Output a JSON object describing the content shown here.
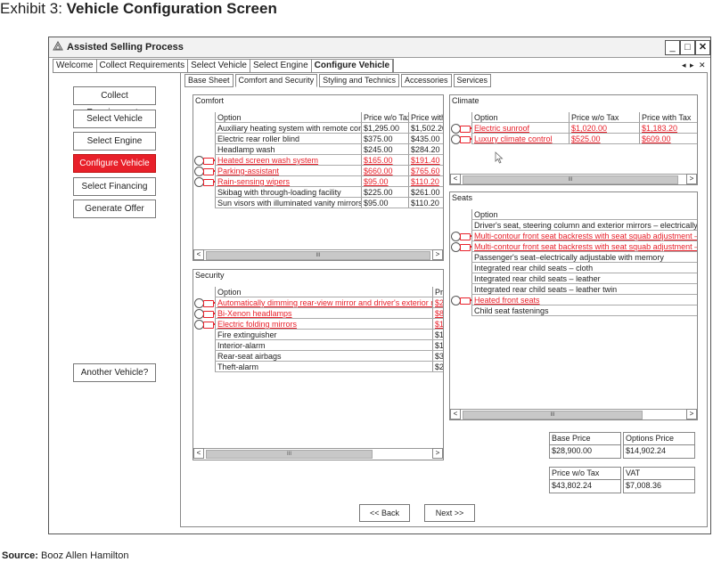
{
  "exhibit": {
    "prefix": "Exhibit 3: ",
    "title": "Vehicle Configuration Screen"
  },
  "source": {
    "label": "Source:",
    "text": " Booz Allen Hamilton"
  },
  "window": {
    "title": "Assisted Selling Process",
    "controls": {
      "minimize": "_",
      "maximize": "□",
      "close": "✕"
    }
  },
  "process_tabs": [
    "Welcome",
    "Collect Requirements",
    "Select Vehicle",
    "Select Engine",
    "Configure Vehicle"
  ],
  "tab_nav": {
    "left": "◂",
    "right": "▸",
    "close": "✕"
  },
  "sidebar": {
    "items": [
      "Collect Requirements",
      "Select Vehicle",
      "Select Engine",
      "Configure Vehicle",
      "Select Financing",
      "Generate Offer"
    ],
    "another": "Another Vehicle?"
  },
  "config_tabs": [
    "Base Sheet",
    "Comfort and Security",
    "Styling and Technics",
    "Accessories",
    "Services"
  ],
  "comfort": {
    "title": "Comfort",
    "headers": [
      "Option",
      "Price w/o Tax",
      "Price with"
    ],
    "rows": [
      {
        "option": "Auxiliary heating system with remote conrol",
        "p1": "$1,295.00",
        "p2": "$1,502.20",
        "sel": false
      },
      {
        "option": "Electric rear roller blind",
        "p1": "$375.00",
        "p2": "$435.00",
        "sel": false
      },
      {
        "option": "Headlamp wash",
        "p1": "$245.00",
        "p2": "$284.20",
        "sel": false
      },
      {
        "option": "Heated screen wash system",
        "p1": "$165.00",
        "p2": "$191.40",
        "sel": true
      },
      {
        "option": "Parking-assistant",
        "p1": "$660.00",
        "p2": "$765.60",
        "sel": true
      },
      {
        "option": "Rain-sensing wipers",
        "p1": "$95.00",
        "p2": "$110.20",
        "sel": true
      },
      {
        "option": "Skibag with through-loading facility",
        "p1": "$225.00",
        "p2": "$261.00",
        "sel": false
      },
      {
        "option": "Sun visors with illuminated vanity mirrors",
        "p1": "$95.00",
        "p2": "$110.20",
        "sel": false
      }
    ]
  },
  "security": {
    "title": "Security",
    "headers": [
      "Option",
      "Pri"
    ],
    "rows": [
      {
        "option": "Automatically dimming rear-view mirror and driver's exterior mirror",
        "p1": "$2",
        "sel": true
      },
      {
        "option": "Bi-Xenon headlamps",
        "p1": "$8",
        "sel": true
      },
      {
        "option": "Electric folding mirrors",
        "p1": "$1",
        "sel": true
      },
      {
        "option": "Fire extinguisher",
        "p1": "$1",
        "sel": false
      },
      {
        "option": "Interior-alarm",
        "p1": "$1",
        "sel": false
      },
      {
        "option": "Rear-seat airbags",
        "p1": "$3",
        "sel": false
      },
      {
        "option": "Theft-alarm",
        "p1": "$2",
        "sel": false
      }
    ]
  },
  "climate": {
    "title": "Climate",
    "headers": [
      "Option",
      "Price w/o Tax",
      "Price with Tax"
    ],
    "rows": [
      {
        "option": "Electric sunroof",
        "p1": "$1,020.00",
        "p2": "$1,183.20",
        "sel": true
      },
      {
        "option": "Luxury climate control",
        "p1": "$525.00",
        "p2": "$609.00",
        "sel": true
      }
    ]
  },
  "seats": {
    "title": "Seats",
    "headers": [
      "Option"
    ],
    "rows": [
      {
        "option": "Driver's seat, steering column and exterior mirrors – electrically adj",
        "sel": false
      },
      {
        "option": "Multi-contour front seat backrests with seat squab adjustment – left",
        "sel": true
      },
      {
        "option": "Multi-contour front seat backrests with seat squab adjustment – righ",
        "sel": true
      },
      {
        "option": "Passenger's seat–electrically adjustable with memory",
        "sel": false
      },
      {
        "option": "Integrated rear child seats – cloth",
        "sel": false
      },
      {
        "option": "Integrated rear child seats – leather",
        "sel": false
      },
      {
        "option": "Integrated rear child seats – leather twin",
        "sel": false
      },
      {
        "option": "Heated front seats",
        "sel": true
      },
      {
        "option": "Child seat fastenings",
        "sel": false
      }
    ]
  },
  "scroll": {
    "left": "<",
    "right": ">",
    "thumb": "III"
  },
  "summary": {
    "base_price": {
      "label": "Base Price",
      "value": "$28,900.00"
    },
    "options_price": {
      "label": "Options Price",
      "value": "$14,902.24"
    },
    "price_wo_tax": {
      "label": "Price w/o Tax",
      "value": "$43,802.24"
    },
    "vat": {
      "label": "VAT",
      "value": "$7,008.36"
    }
  },
  "nav": {
    "back": "<< Back",
    "next": "Next >>"
  },
  "colors": {
    "accent": "#e8202a"
  }
}
